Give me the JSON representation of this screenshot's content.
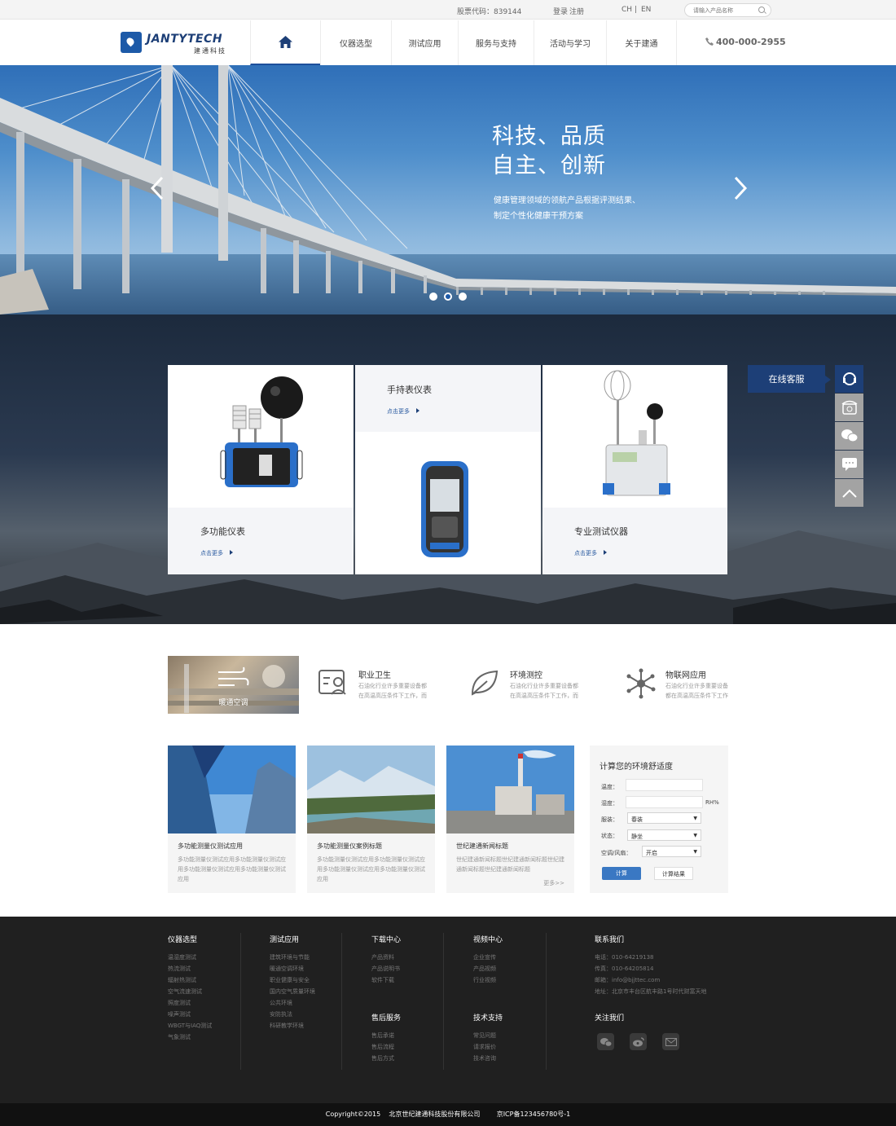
{
  "topbar": {
    "stock": "股票代码：839144",
    "login": "登录",
    "register": "注册",
    "lang_cn": "CH",
    "lang_sep": "|",
    "lang_en": "EN",
    "search_placeholder": "请输入产品名称"
  },
  "logo": {
    "en": "JANTYTECH",
    "cn": "建通科技"
  },
  "nav": {
    "items": [
      "仪器选型",
      "测试应用",
      "服务与支持",
      "活动与学习",
      "关于建通"
    ],
    "phone": "400-000-2955"
  },
  "banner": {
    "line1": "科技、品质",
    "line2": "自主、创新",
    "sub1": "健康管理领域的领航产品根据评测结果、",
    "sub2": "制定个性化健康干预方案",
    "active_slide": 2,
    "slide_count": 3
  },
  "products": [
    {
      "title": "多功能仪表",
      "more": "点击更多"
    },
    {
      "title": "手持表仪表",
      "more": "点击更多"
    },
    {
      "title": "专业测试仪器",
      "more": "点击更多"
    }
  ],
  "service": {
    "chat": "在线客服"
  },
  "categories": {
    "image_label": "暖通空调",
    "items": [
      {
        "title": "职业卫生",
        "desc": "石油化行业许多重要设备都在高温高压条件下工作，而"
      },
      {
        "title": "环境测控",
        "desc": "石油化行业许多重要设备都在高温高压条件下工作，而"
      },
      {
        "title": "物联网应用",
        "desc": "石油化行业许多重要设备都在高温高压条件下工作"
      }
    ]
  },
  "news": [
    {
      "title": "多功能测量仪测试应用",
      "desc": "多功能测量仪测试应用多功能测量仪测试应用多功能测量仪测试应用多功能测量仪测试应用",
      "more": ""
    },
    {
      "title": "多功能测量仪案例标题",
      "desc": "多功能测量仪测试应用多功能测量仪测试应用多功能测量仪测试应用多功能测量仪测试应用",
      "more": ""
    },
    {
      "title": "世纪建通新闻标题",
      "desc": "世纪建通新闻标题世纪建通新闻标题世纪建通新闻标题世纪建通新闻标题",
      "more": "更多>>"
    }
  ],
  "calc": {
    "title": "计算您的环境舒适度",
    "temp_label": "温度：",
    "humid_label": "湿度：",
    "humid_unit": "RH%",
    "clothing_label": "服装：",
    "clothing_value": "春装",
    "state_label": "状态：",
    "state_value": "静坐",
    "ac_label": "空调/风扇：",
    "ac_value": "开启",
    "calc_btn": "计算",
    "result_btn": "计算结果"
  },
  "footer": {
    "col1": {
      "head": "仪器选型",
      "links": [
        "温湿度测试",
        "热流测试",
        "辐射热测试",
        "空气流速测试",
        "照度测试",
        "噪声测试",
        "WBGT与IAQ测试",
        "气象测试"
      ]
    },
    "col2": {
      "head": "测试应用",
      "links": [
        "建筑环境与节能",
        "暖通空调环境",
        "职业健康与安全",
        "国内空气质量环境",
        "公共环境",
        "安防执法",
        "科研教学环境"
      ]
    },
    "col3": {
      "head": "下载中心",
      "links": [
        "产品资料",
        "产品说明书",
        "软件下载"
      ]
    },
    "col4": {
      "head": "视频中心",
      "links": [
        "企业宣传",
        "产品视频",
        "行业视频"
      ]
    },
    "col5": {
      "head": "售后服务",
      "links": [
        "售后承诺",
        "售后流程",
        "售后方式"
      ]
    },
    "col6": {
      "head": "技术支持",
      "links": [
        "常见问题",
        "请求报价",
        "技术咨询"
      ]
    },
    "contact": {
      "head": "联系我们",
      "tel": "电话：010-64219138",
      "fax": "传真：010-64205814",
      "email": "邮箱：info@bjjttec.com",
      "addr": "地址：北京市丰台区航丰路1号时代财富天地"
    },
    "follow": "关注我们"
  },
  "copyright": {
    "text": "Copyright©2015    北京世纪建通科技股份有限公司        京ICP备123456780号-1"
  },
  "colors": {
    "brand": "#1d3f77",
    "accent": "#3a78c3",
    "footer": "#202020"
  }
}
